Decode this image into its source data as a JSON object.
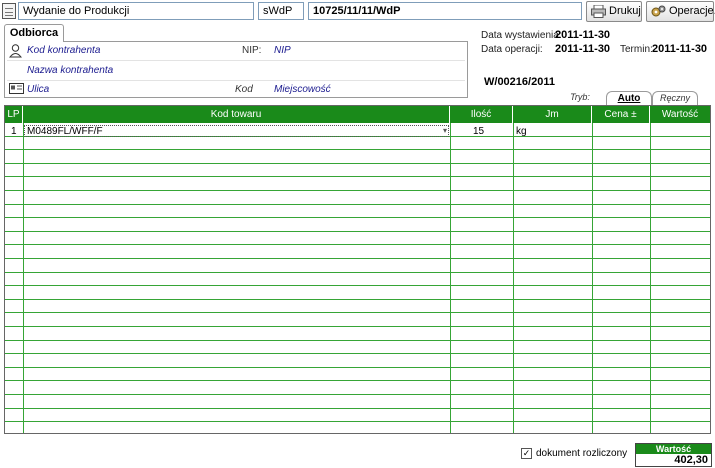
{
  "header": {
    "doc_type": "Wydanie do Produkcji",
    "series": "sWdP",
    "doc_number": "10725/11/11/WdP",
    "print_label": "Drukuj",
    "operations_label": "Operacje..."
  },
  "odbiorca": {
    "tab_label": "Odbiorca",
    "kod_kontrahenta": "Kod kontrahenta",
    "nip_label": "NIP:",
    "nip_value": "NIP",
    "nazwa_kontrahenta": "Nazwa kontrahenta",
    "ulica": "Ulica",
    "kod_label": "Kod",
    "miejscowosc": "Miejscowość"
  },
  "info": {
    "data_wystawienia_label": "Data wystawienia:",
    "data_wystawienia": "2011-11-30",
    "data_operacji_label": "Data operacji:",
    "data_operacji": "2011-11-30",
    "termin_label": "Termin:",
    "termin": "2011-11-30",
    "ref_number": "W/00216/2011"
  },
  "mode_tabs": [
    "Tryb:",
    "Auto",
    "Ręczny"
  ],
  "grid": {
    "columns": [
      "LP",
      "Kod towaru",
      "Ilość",
      "Jm",
      "Cena ±",
      "Wartość"
    ],
    "rows": [
      {
        "lp": "1",
        "kod": "M0489FL/WFF/F",
        "ilosc": "15",
        "jm": "kg"
      }
    ],
    "empty_rows": 22
  },
  "footer": {
    "dokument_rozliczony_label": "dokument rozliczony",
    "dokument_rozliczony_checked": true,
    "check_mark": "✓",
    "wartosc_label": "Wartość",
    "wartosc_value": "402,30"
  },
  "colors": {
    "grid_header": "#1a8a1a",
    "grid_lines": "#36a536"
  },
  "icons": [
    "document-icon",
    "printer-icon",
    "gears-icon",
    "contact-icon",
    "address-card-icon",
    "dropdown-arrow-icon"
  ]
}
